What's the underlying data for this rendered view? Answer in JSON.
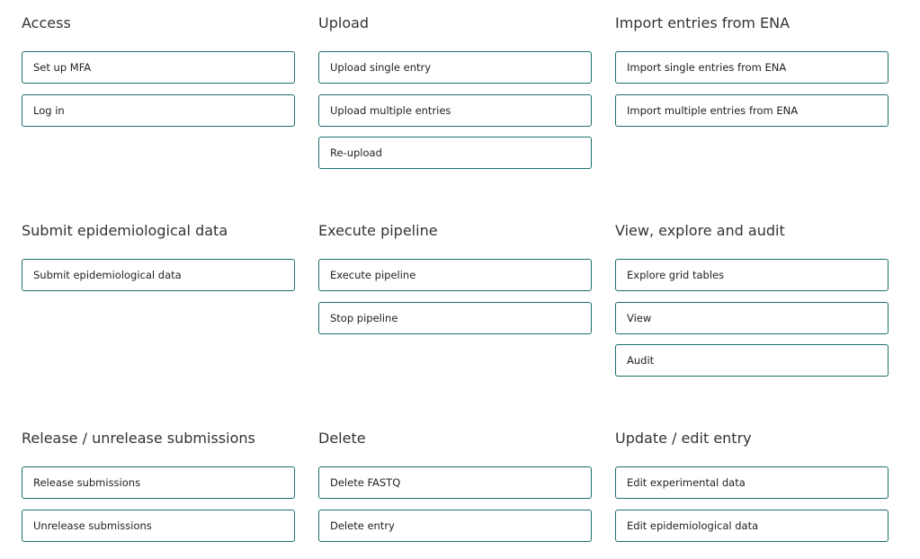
{
  "sections": [
    {
      "title": "Access",
      "buttons": [
        "Set up MFA",
        "Log in"
      ]
    },
    {
      "title": "Upload",
      "buttons": [
        "Upload single entry",
        "Upload multiple entries",
        "Re-upload"
      ]
    },
    {
      "title": "Import entries from ENA",
      "buttons": [
        "Import single entries from ENA",
        "Import multiple entries from ENA"
      ]
    },
    {
      "title": "Submit epidemiological data",
      "buttons": [
        "Submit epidemiological data"
      ]
    },
    {
      "title": "Execute pipeline",
      "buttons": [
        "Execute pipeline",
        "Stop pipeline"
      ]
    },
    {
      "title": "View, explore and audit",
      "buttons": [
        "Explore grid tables",
        "View",
        "Audit"
      ]
    },
    {
      "title": "Release / unrelease submissions",
      "buttons": [
        "Release submissions",
        "Unrelease submissions"
      ]
    },
    {
      "title": "Delete",
      "buttons": [
        "Delete FASTQ",
        "Delete entry"
      ]
    },
    {
      "title": "Update / edit entry",
      "buttons": [
        "Edit experimental data",
        "Edit epidemiological data"
      ]
    }
  ],
  "colors": {
    "button_border": "#1b6f6a",
    "heading_text": "#333333",
    "button_text": "#222222",
    "background": "#ffffff"
  }
}
